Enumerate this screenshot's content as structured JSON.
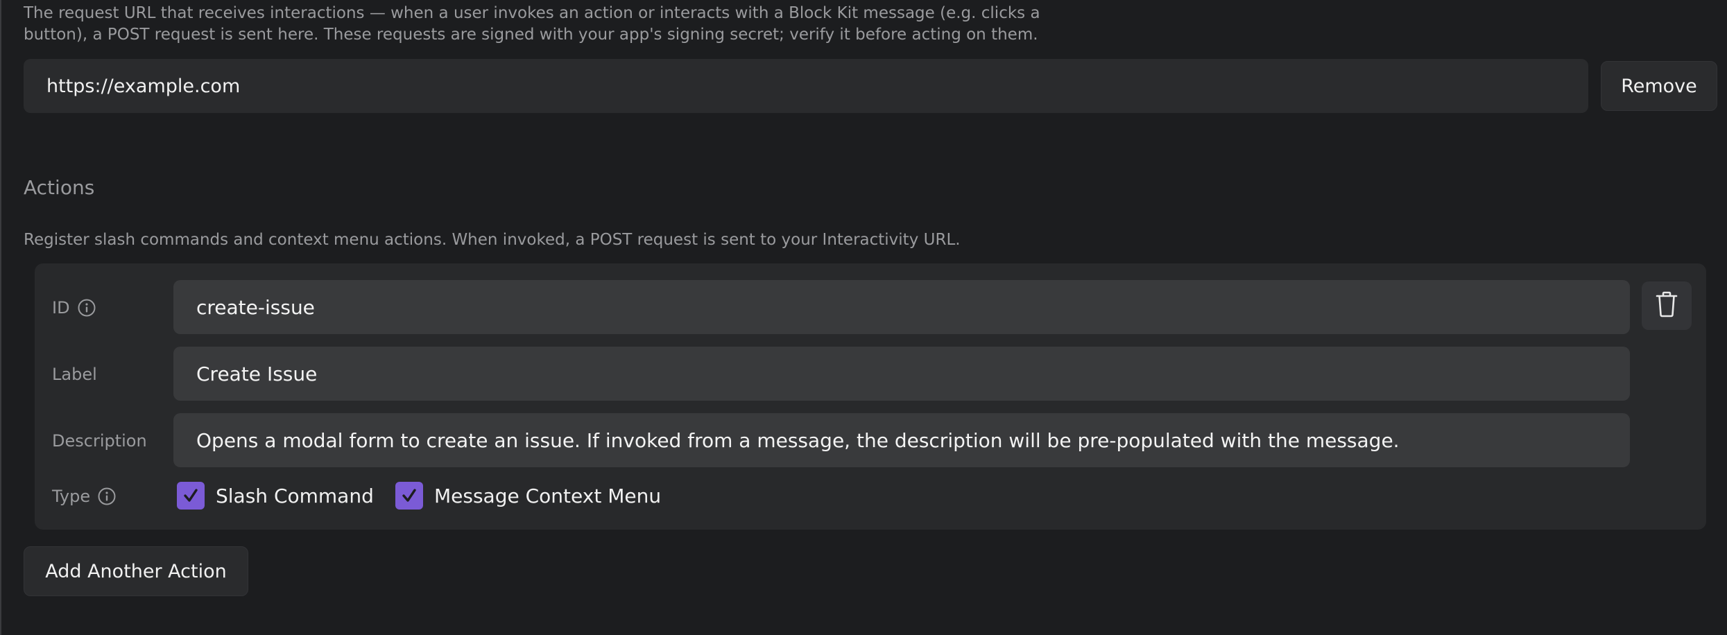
{
  "interactivity": {
    "help_text": "The request URL that receives interactions — when a user invokes an action or interacts with a Block Kit message (e.g. clicks a button), a POST request is sent here. These requests are signed with your app's signing secret; verify it before acting on them.",
    "url_value": "https://example.com",
    "remove_label": "Remove"
  },
  "actions": {
    "title": "Actions",
    "help_text": "Register slash commands and context menu actions. When invoked, a POST request is sent to your Interactivity URL.",
    "items": [
      {
        "id_label": "ID",
        "id_value": "create-issue",
        "label_label": "Label",
        "label_value": "Create Issue",
        "description_label": "Description",
        "description_value": "Opens a modal form to create an issue. If invoked from a message, the description will be pre-populated with the message.",
        "type_label": "Type",
        "types": [
          {
            "label": "Slash Command",
            "checked": true
          },
          {
            "label": "Message Context Menu",
            "checked": true
          }
        ]
      }
    ],
    "add_label": "Add Another Action"
  },
  "colors": {
    "background": "#1c1d1f",
    "card": "#28292b",
    "field": "#393a3c",
    "checkbox_accent": "#7b5bd6",
    "muted_text": "#9a9b9e"
  },
  "icons": {
    "info": "info-icon",
    "trash": "trash-icon",
    "check": "check-icon"
  }
}
